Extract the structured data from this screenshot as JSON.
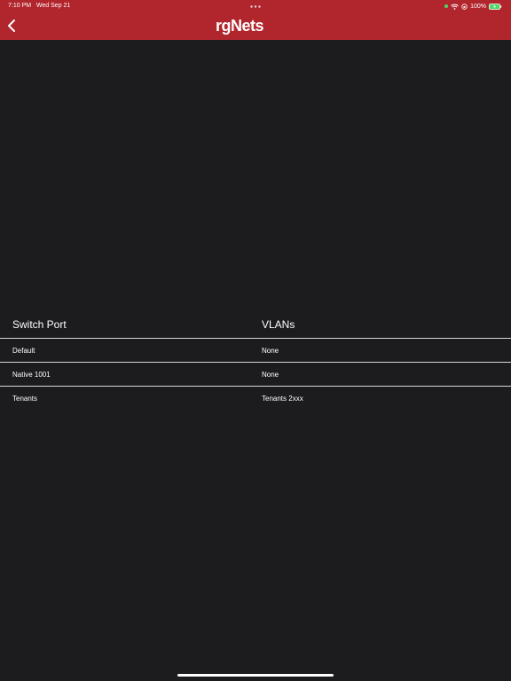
{
  "status_bar": {
    "time": "7:10 PM",
    "date": "Wed Sep 21",
    "battery": "100%",
    "icons": [
      "recording-dot-icon",
      "wifi-icon",
      "lock-rotation-icon",
      "battery-charging-icon"
    ],
    "recording_color": "#4cd964"
  },
  "nav": {
    "back_icon": "chevron-left-icon",
    "logo_text": "rgNets",
    "bar_color": "#b1252d"
  },
  "table": {
    "headers": {
      "switch_port": "Switch Port",
      "vlans": "VLANs"
    },
    "rows": [
      {
        "port": "Default",
        "vlans": "None"
      },
      {
        "port": "Native 1001",
        "vlans": "None"
      },
      {
        "port": "Tenants",
        "vlans": "Tenants 2xxx"
      }
    ]
  },
  "colors": {
    "background": "#1c1c1e",
    "divider": "#d8d8d8",
    "text": "#ffffff"
  }
}
